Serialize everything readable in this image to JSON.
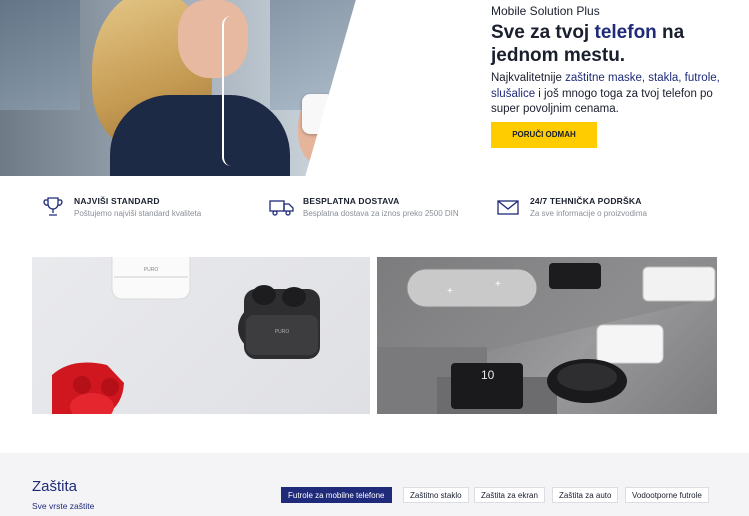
{
  "hero": {
    "brand": "Mobile Solution Plus",
    "headline_pre": "Sve za tvoj ",
    "headline_accent": "telefon",
    "headline_post": " na jednom mestu.",
    "desc_pre": "Najkvalitetnije ",
    "desc_accent": "zaštitne maske, stakla, futrole, slušalice",
    "desc_post": " i još mnogo toga za tvoj telefon po super povoljnim cenama.",
    "cta_label": "PORUČI ODMAH"
  },
  "features": [
    {
      "title": "NAJVIŠI STANDARD",
      "subtitle": "Poštujemo najviši standard kvaliteta",
      "icon": "trophy-icon"
    },
    {
      "title": "BESPLATNA DOSTAVA",
      "subtitle": "Besplatna dostava za iznos preko 2500 DIN",
      "icon": "truck-icon"
    },
    {
      "title": "24/7 TEHNIČKA PODRŠKA",
      "subtitle": "Za sve informacije o proizvodima",
      "icon": "mail-icon"
    }
  ],
  "banners": {
    "left_brand_small": "PURO",
    "left_brand_case": "PURO",
    "right_powerbank": "10"
  },
  "category": {
    "title": "Zaštita",
    "subtitle": "Sve vrste zaštite",
    "tabs": [
      {
        "label": "Futrole za mobilne telefone",
        "active": true
      },
      {
        "label": "Zaštitno staklo",
        "active": false
      },
      {
        "label": "Zaštita za ekran",
        "active": false
      },
      {
        "label": "Zaštita za auto",
        "active": false
      },
      {
        "label": "Vodootporne futrole",
        "active": false
      }
    ]
  },
  "colors": {
    "accent": "#1f2a7a",
    "cta": "#ffcc00",
    "muted_text": "#8a8f99"
  }
}
